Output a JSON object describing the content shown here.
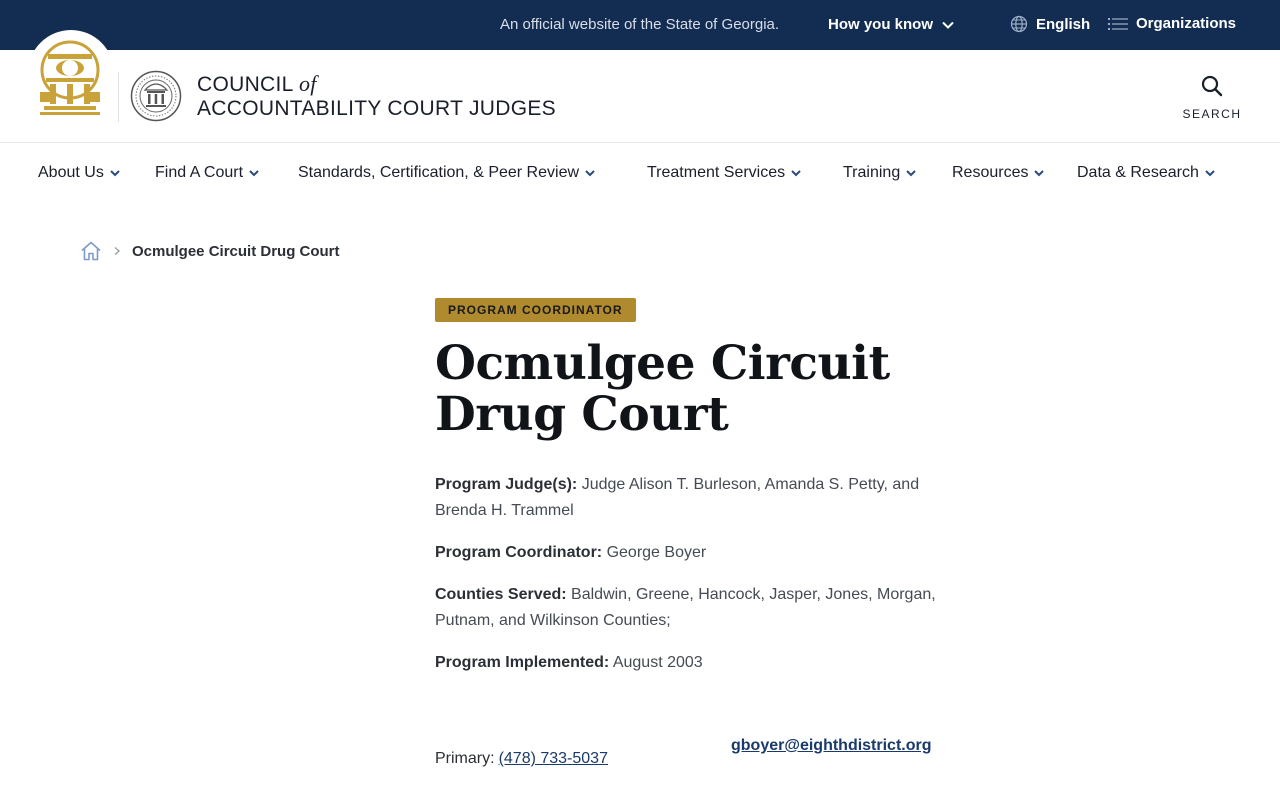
{
  "topbar": {
    "official_text": "An official website of the State of Georgia.",
    "how_you_know": "How you know",
    "language": "English",
    "organizations": "Organizations"
  },
  "header": {
    "title_line1_a": "COUNCIL",
    "title_line1_of": "of",
    "title_line2": "ACCOUNTABILITY COURT JUDGES",
    "search_label": "SEARCH"
  },
  "nav": {
    "items": [
      {
        "label": "About Us"
      },
      {
        "label": "Find A Court"
      },
      {
        "label": "Standards, Certification, & Peer Review"
      },
      {
        "label": "Treatment Services"
      },
      {
        "label": "Training"
      },
      {
        "label": "Resources"
      },
      {
        "label": "Data & Research"
      }
    ]
  },
  "breadcrumb": {
    "current": "Ocmulgee Circuit Drug Court"
  },
  "main": {
    "badge": "PROGRAM COORDINATOR",
    "title": "Ocmulgee Circuit Drug Court",
    "details": [
      {
        "label": "Program Judge(s):",
        "value": "Judge Alison T. Burleson, Amanda S. Petty, and Brenda H. Trammel"
      },
      {
        "label": "Program Coordinator:",
        "value": " George Boyer"
      },
      {
        "label": "Counties Served:",
        "value": "Baldwin, Greene, Hancock, Jasper, Jones, Morgan, Putnam, and Wilkinson Counties;"
      },
      {
        "label": "Program Implemented:",
        "value": "August 2003"
      }
    ],
    "contact": {
      "primary_label": "Primary:",
      "phone": "(478) 733-5037",
      "email": "gboyer@eighthdistrict.org"
    }
  },
  "colors": {
    "topbar_bg": "#132d52",
    "badge_bg": "#b08a2e",
    "seal_gold": "#c9a23a",
    "link": "#1a3a6b"
  }
}
